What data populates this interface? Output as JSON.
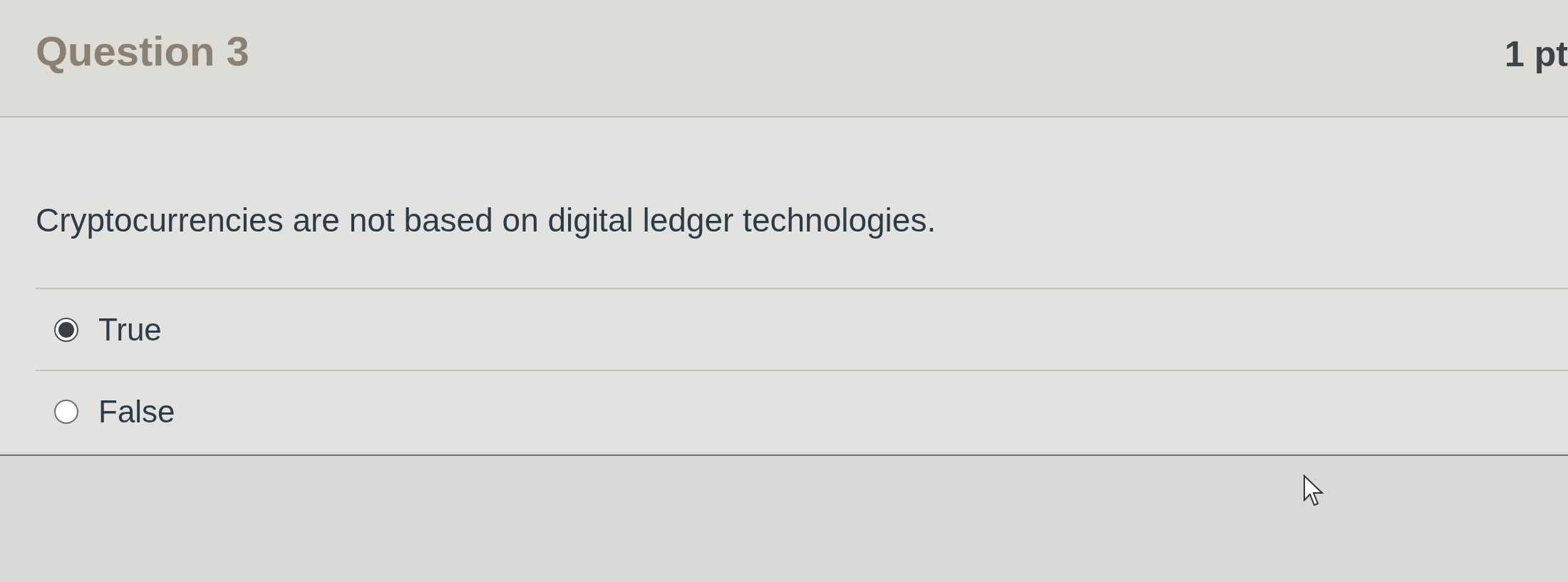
{
  "question": {
    "title": "Question 3",
    "points": "1 pt"
  },
  "prompt": "Cryptocurrencies are not based on digital ledger technologies.",
  "options": [
    {
      "label": "True",
      "selected": true
    },
    {
      "label": "False",
      "selected": false
    }
  ]
}
